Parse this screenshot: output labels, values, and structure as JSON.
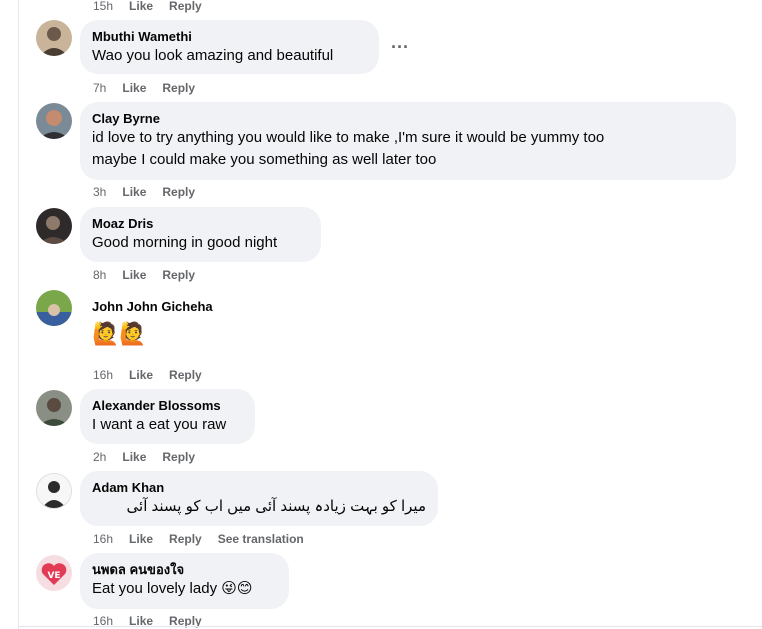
{
  "top_actions": {
    "time": "15h",
    "like": "Like",
    "reply": "Reply"
  },
  "comments": [
    {
      "author": "Mbuthi Wamethi",
      "text": "Wao you look amazing and beautiful",
      "time": "7h",
      "like": "Like",
      "reply": "Reply",
      "more_label": "···"
    },
    {
      "author": "Clay Byrne",
      "text_line1": "id love to try anything you would like to make ,I'm sure it would be yummy too",
      "text_line2": "maybe I could make you something as well later too",
      "time": "3h",
      "like": "Like",
      "reply": "Reply"
    },
    {
      "author": "Moaz Dris",
      "text": "Good morning in good night",
      "time": "8h",
      "like": "Like",
      "reply": "Reply"
    },
    {
      "author": "John John Gicheha",
      "text": "🙋🙋",
      "time": "16h",
      "like": "Like",
      "reply": "Reply"
    },
    {
      "author": "Alexander Blossoms",
      "text": "I want a eat you raw",
      "time": "2h",
      "like": "Like",
      "reply": "Reply"
    },
    {
      "author": "Adam Khan",
      "text": "میرا کو بہت زیادہ پسند آئی میں اب کو پسند آئی",
      "time": "16h",
      "like": "Like",
      "reply": "Reply",
      "see_translation": "See translation"
    },
    {
      "author": "นพดล คนของใจ",
      "text": "Eat you lovely lady 😜😊",
      "time": "16h",
      "like": "Like",
      "reply": "Reply"
    }
  ],
  "avatars": [
    {
      "icon": "avatar-photo",
      "colors": [
        "#6b5a4b",
        "#c9b49a"
      ]
    },
    {
      "icon": "avatar-photo",
      "colors": [
        "#7a8a96",
        "#c58b6f"
      ]
    },
    {
      "icon": "avatar-photo",
      "colors": [
        "#2f2a2a",
        "#8d7a6a"
      ]
    },
    {
      "icon": "avatar-photo",
      "colors": [
        "#7aa74a",
        "#3a5f9e"
      ]
    },
    {
      "icon": "avatar-photo",
      "colors": [
        "#3b4a3a",
        "#8a8f86"
      ]
    },
    {
      "icon": "avatar-silhouette",
      "colors": [
        "#e4e6eb",
        "#2b2b2b"
      ]
    },
    {
      "icon": "avatar-love-badge",
      "colors": [
        "#e23b55",
        "#ffffff"
      ]
    }
  ]
}
